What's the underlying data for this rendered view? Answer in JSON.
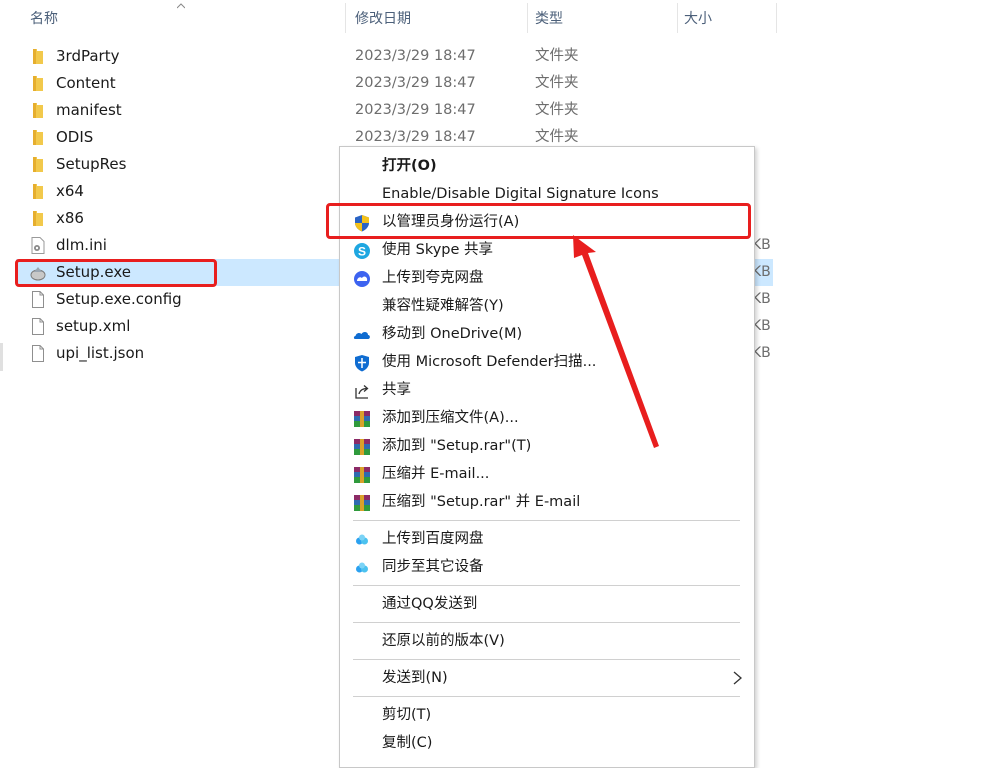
{
  "columns": {
    "name": "名称",
    "modified": "修改日期",
    "type": "类型",
    "size": "大小"
  },
  "files": [
    {
      "name": "3rdParty",
      "date": "2023/3/29 18:47",
      "type": "文件夹",
      "size": "",
      "icon": "folder-icon"
    },
    {
      "name": "Content",
      "date": "2023/3/29 18:47",
      "type": "文件夹",
      "size": "",
      "icon": "folder-icon"
    },
    {
      "name": "manifest",
      "date": "2023/3/29 18:47",
      "type": "文件夹",
      "size": "",
      "icon": "folder-icon"
    },
    {
      "name": "ODIS",
      "date": "2023/3/29 18:47",
      "type": "文件夹",
      "size": "",
      "icon": "folder-icon"
    },
    {
      "name": "SetupRes",
      "date": "",
      "type": "",
      "size": "",
      "icon": "folder-icon"
    },
    {
      "name": "x64",
      "date": "",
      "type": "",
      "size": "",
      "icon": "folder-icon"
    },
    {
      "name": "x86",
      "date": "",
      "type": "",
      "size": "",
      "icon": "folder-icon"
    },
    {
      "name": "dlm.ini",
      "date": "",
      "type": "",
      "size": "KB",
      "icon": "ini-file-icon"
    },
    {
      "name": "Setup.exe",
      "date": "",
      "type": "",
      "size": "KB",
      "icon": "installer-exe-icon",
      "selected": true
    },
    {
      "name": "Setup.exe.config",
      "date": "",
      "type": "",
      "size": "KB",
      "icon": "file-icon"
    },
    {
      "name": "setup.xml",
      "date": "",
      "type": "",
      "size": "KB",
      "icon": "file-icon"
    },
    {
      "name": "upi_list.json",
      "date": "",
      "type": "",
      "size": "KB",
      "icon": "file-icon"
    }
  ],
  "context_menu": {
    "items": [
      {
        "label": "打开(O)",
        "icon": "",
        "bold": true
      },
      {
        "label": "Enable/Disable Digital Signature Icons",
        "icon": ""
      },
      {
        "label": "以管理员身份运行(A)",
        "icon": "uac-shield-icon"
      },
      {
        "label": "使用 Skype 共享",
        "icon": "skype-icon"
      },
      {
        "label": "上传到夸克网盘",
        "icon": "quark-cloud-icon"
      },
      {
        "label": "兼容性疑难解答(Y)",
        "icon": ""
      },
      {
        "label": "移动到 OneDrive(M)",
        "icon": "onedrive-icon"
      },
      {
        "label": "使用 Microsoft Defender扫描...",
        "icon": "defender-shield-icon"
      },
      {
        "label": "共享",
        "icon": "share-icon"
      },
      {
        "label": "添加到压缩文件(A)...",
        "icon": "winrar-icon"
      },
      {
        "label": "添加到 \"Setup.rar\"(T)",
        "icon": "winrar-icon"
      },
      {
        "label": "压缩并 E-mail...",
        "icon": "winrar-icon"
      },
      {
        "label": "压缩到 \"Setup.rar\" 并 E-mail",
        "icon": "winrar-icon"
      },
      {
        "separator": true
      },
      {
        "label": "上传到百度网盘",
        "icon": "baidu-netdisk-icon"
      },
      {
        "label": "同步至其它设备",
        "icon": "baidu-netdisk-icon"
      },
      {
        "separator": true
      },
      {
        "label": "通过QQ发送到",
        "icon": ""
      },
      {
        "separator": true
      },
      {
        "label": "还原以前的版本(V)",
        "icon": ""
      },
      {
        "separator": true
      },
      {
        "label": "发送到(N)",
        "icon": "",
        "submenu": true
      },
      {
        "separator": true
      },
      {
        "label": "剪切(T)",
        "icon": ""
      },
      {
        "label": "复制(C)",
        "icon": ""
      }
    ]
  },
  "colors": {
    "selection": "#cce8ff",
    "annotation": "#e81e1e",
    "folder": "#f2c94c"
  }
}
